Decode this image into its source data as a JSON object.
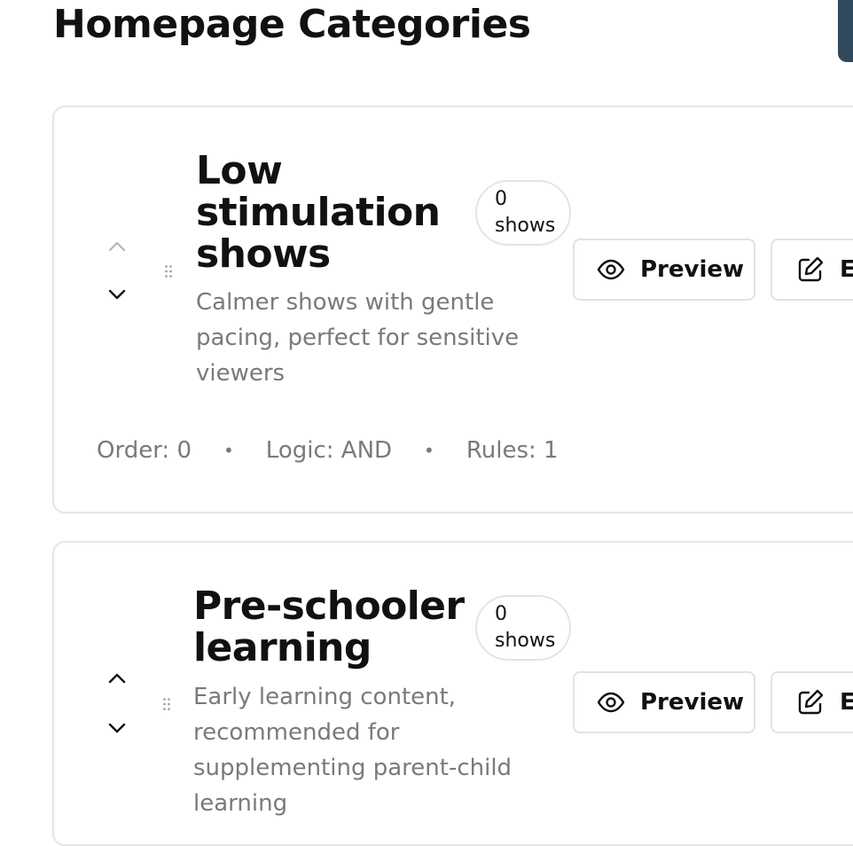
{
  "page": {
    "title": "Homepage Categories"
  },
  "categories": [
    {
      "title": "Low stimulation shows",
      "count_number": "0",
      "count_unit": "shows",
      "description": "Calmer shows with gentle pacing, perfect for sensitive viewers",
      "preview_label": "Preview",
      "edit_label": "Ed",
      "order": "Order: 0",
      "logic": "Logic: AND",
      "rules": "Rules: 1"
    },
    {
      "title": "Pre-schooler learning",
      "count_number": "0",
      "count_unit": "shows",
      "description": "Early learning content, recommended for supplementing parent-child learning",
      "preview_label": "Preview",
      "edit_label": "Ed"
    }
  ],
  "icons": {
    "move_up": "chevron-up-icon",
    "move_down": "chevron-down-icon",
    "drag": "drag-handle-icon",
    "preview": "eye-icon",
    "edit": "edit-icon"
  },
  "colors": {
    "text": "#111111",
    "muted": "#7a7a7a",
    "border": "#e4e4e4",
    "accent": "#2f4a5c"
  },
  "meta_separator": "•"
}
